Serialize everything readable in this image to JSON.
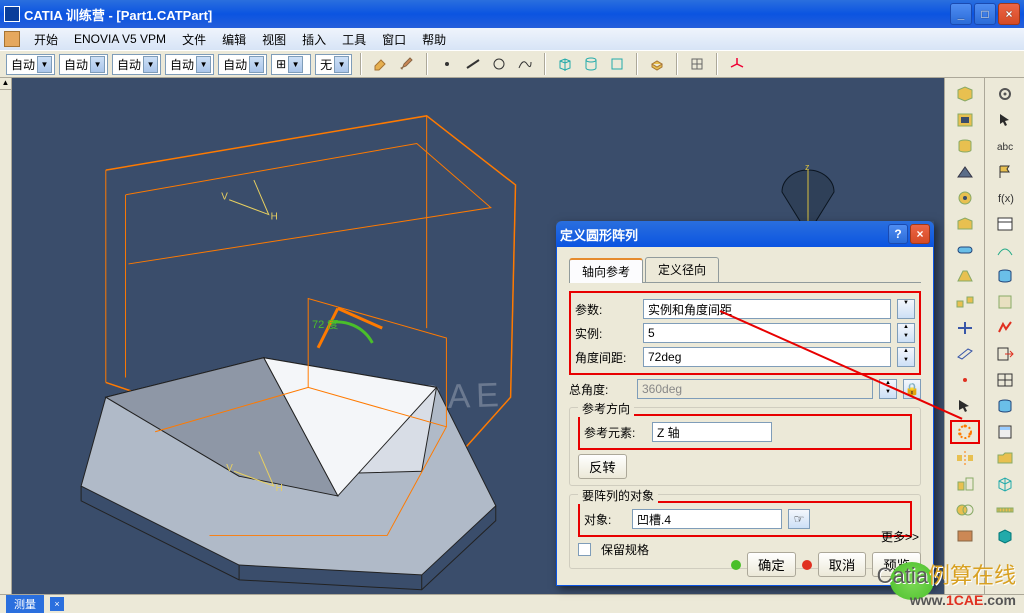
{
  "window": {
    "app_title": "CATIA 训练营 - [Part1.CATPart]",
    "min": "_",
    "max": "□",
    "close": "×"
  },
  "menu": {
    "start": "开始",
    "enovia": "ENOVIA V5 VPM",
    "file": "文件",
    "edit": "编辑",
    "view": "视图",
    "insert": "插入",
    "tools": "工具",
    "window": "窗口",
    "help": "帮助"
  },
  "toolbar": {
    "auto": "自动",
    "none": "无"
  },
  "status": {
    "measure": "测量"
  },
  "dialog": {
    "title": "定义圆形阵列",
    "help": "?",
    "close": "×",
    "tabs": {
      "axial": "轴向参考",
      "crown": "定义径向"
    },
    "params_label": "参数:",
    "params_value": "实例和角度间距",
    "instances_label": "实例:",
    "instances_value": "5",
    "angle_spacing_label": "角度间距:",
    "angle_spacing_value": "72deg",
    "total_angle_label": "总角度:",
    "total_angle_value": "360deg",
    "ref_dir_legend": "参考方向",
    "ref_elem_label": "参考元素:",
    "ref_elem_value": "Z 轴",
    "reverse": "反转",
    "obj_legend": "要阵列的对象",
    "obj_label": "对象:",
    "obj_value": "凹槽.4",
    "keep_spec": "保留规格",
    "more": "更多>>",
    "ok": "确定",
    "cancel": "取消",
    "preview": "预览"
  },
  "viewport_labels": {
    "angle_deg": "72 度",
    "v": "V",
    "h": "H"
  },
  "icons": {
    "pad": "pad",
    "pocket": "pocket",
    "shaft": "shaft",
    "groove": "groove",
    "hole": "hole",
    "rib": "rib",
    "slot": "slot",
    "stiffener": "stiffener",
    "multi": "multi",
    "fillet": "fillet",
    "chamfer": "chamfer",
    "draft": "draft",
    "shell": "shell",
    "thickness": "thickness",
    "thread": "thread",
    "remove": "remove",
    "pattern": "circular-pattern",
    "mirror": "mirror",
    "scale": "scale",
    "gear": "settings",
    "arrow": "select",
    "abc": "annotation",
    "compass": "compass",
    "axis": "axis",
    "plane": "plane",
    "measure": "measure",
    "formula": "formula"
  },
  "watermarks": {
    "center": "1CAE",
    "catia": "Catia",
    "online": "例算在线",
    "url_left": "www.",
    "url_mid": "1CAE",
    "url_right": ".com"
  }
}
